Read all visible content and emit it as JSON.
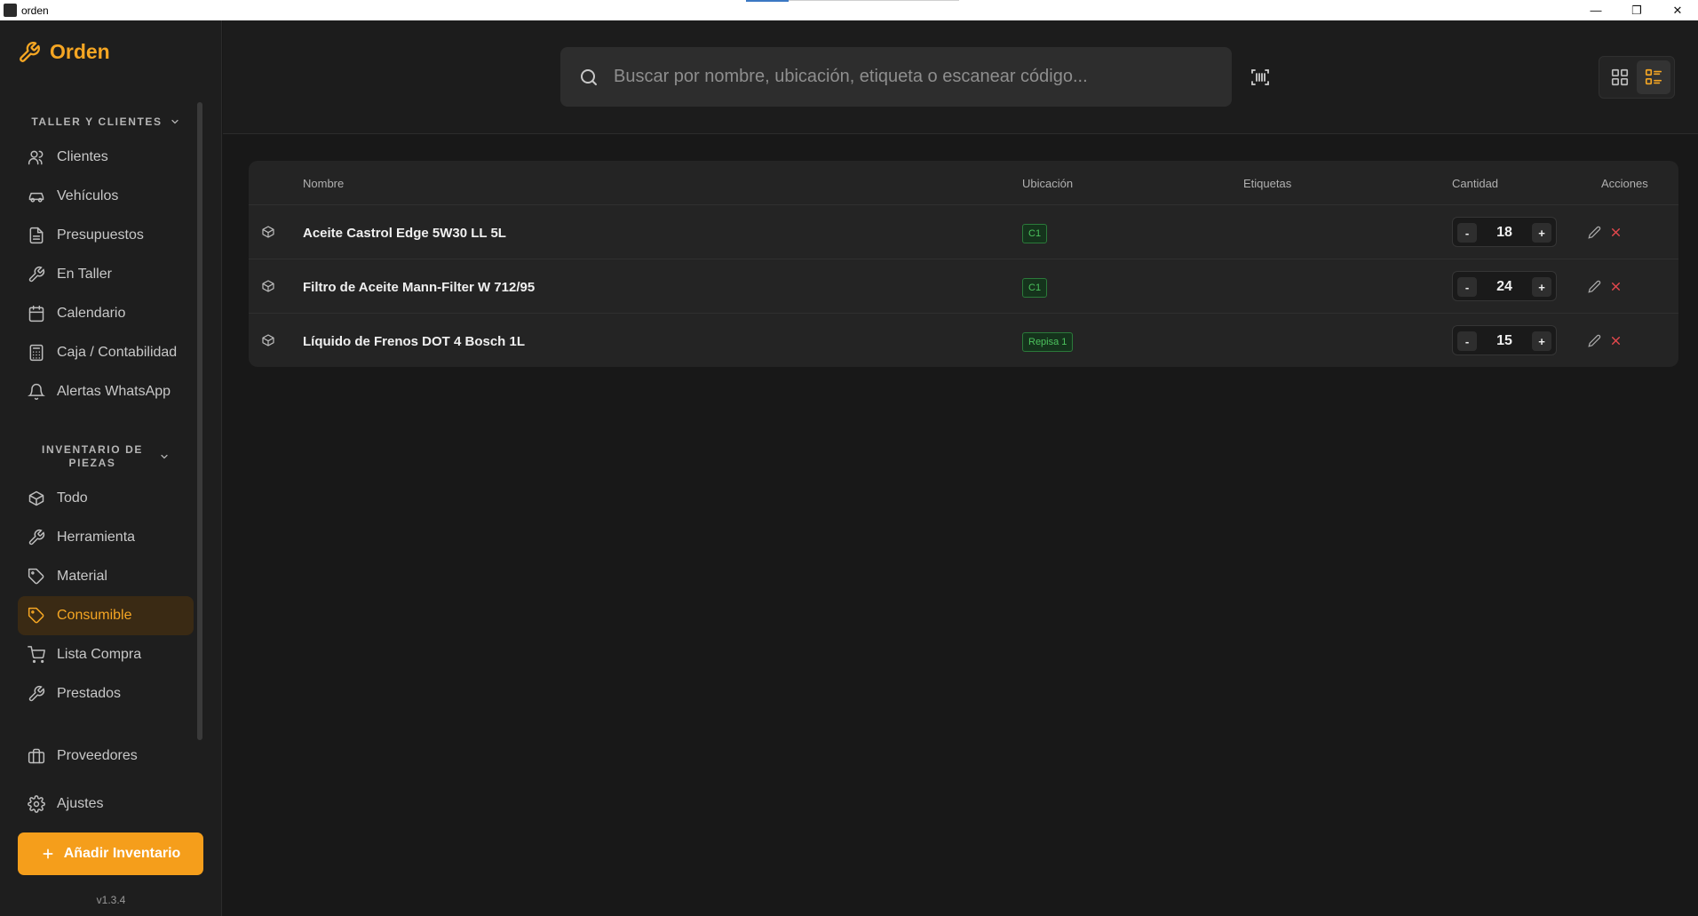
{
  "window": {
    "title": "orden",
    "minimize": "—",
    "restore": "❐",
    "close": "✕"
  },
  "brand": {
    "name": "Orden",
    "accent": "#f5a623"
  },
  "sidebar": {
    "section1": {
      "title": "TALLER Y CLIENTES"
    },
    "section1_items": [
      {
        "label": "Clientes",
        "icon": "users-icon"
      },
      {
        "label": "Vehículos",
        "icon": "car-icon"
      },
      {
        "label": "Presupuestos",
        "icon": "document-icon"
      },
      {
        "label": "En Taller",
        "icon": "wrench-icon"
      },
      {
        "label": "Calendario",
        "icon": "calendar-icon"
      },
      {
        "label": "Caja / Contabilidad",
        "icon": "calculator-icon"
      },
      {
        "label": "Alertas WhatsApp",
        "icon": "bell-icon"
      }
    ],
    "section2": {
      "title_line1": "INVENTARIO DE",
      "title_line2": "PIEZAS"
    },
    "section2_items": [
      {
        "label": "Todo",
        "icon": "box-icon"
      },
      {
        "label": "Herramienta",
        "icon": "wrench-icon"
      },
      {
        "label": "Material",
        "icon": "tag-icon"
      },
      {
        "label": "Consumible",
        "icon": "tag-icon",
        "active": true
      },
      {
        "label": "Lista Compra",
        "icon": "cart-icon"
      },
      {
        "label": "Prestados",
        "icon": "wrench-icon"
      }
    ],
    "bottom_items": [
      {
        "label": "Proveedores",
        "icon": "briefcase-icon"
      },
      {
        "label": "Ajustes",
        "icon": "gear-icon"
      }
    ],
    "add_button": "Añadir Inventario",
    "version": "v1.3.4"
  },
  "search": {
    "placeholder": "Buscar por nombre, ubicación, etiqueta o escanear código..."
  },
  "table": {
    "headers": {
      "name": "Nombre",
      "location": "Ubicación",
      "tags": "Etiquetas",
      "quantity": "Cantidad",
      "actions": "Acciones"
    },
    "rows": [
      {
        "name": "Aceite Castrol Edge 5W30 LL 5L",
        "location": "C1",
        "quantity": "18"
      },
      {
        "name": "Filtro de Aceite Mann-Filter W 712/95",
        "location": "C1",
        "quantity": "24"
      },
      {
        "name": "Líquido de Frenos DOT 4 Bosch 1L",
        "location": "Repisa 1",
        "quantity": "15"
      }
    ],
    "minus_label": "-",
    "plus_label": "+"
  }
}
